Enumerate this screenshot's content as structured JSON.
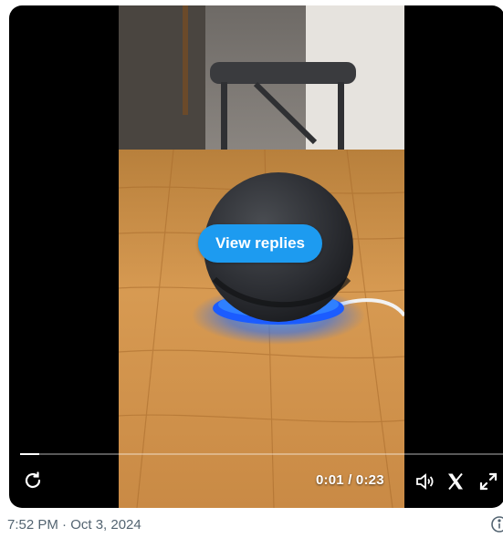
{
  "video": {
    "view_replies_label": "View replies",
    "progress": 0.04,
    "time_display": "0:01 / 0:23",
    "icons": {
      "replay": "replay-icon",
      "volume": "speaker-icon",
      "close": "x-icon",
      "fullscreen": "fullscreen-icon"
    }
  },
  "post": {
    "timestamp": "7:52 PM · Oct 3, 2024"
  },
  "colors": {
    "accent": "#1d9bf0",
    "player_bg": "#000000",
    "muted_text": "#536471"
  }
}
